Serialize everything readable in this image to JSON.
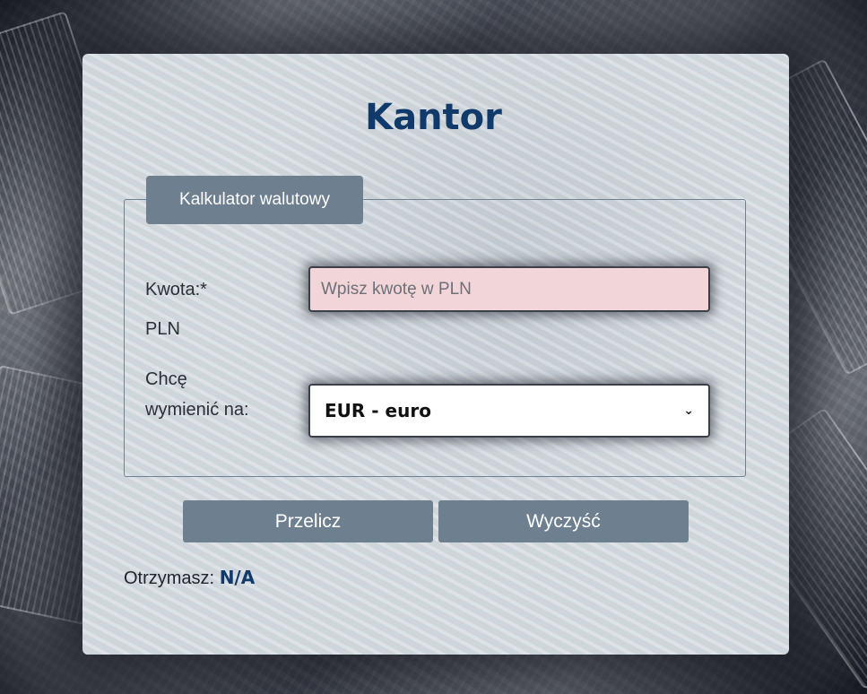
{
  "page": {
    "title": "Kantor"
  },
  "calculator": {
    "legend": "Kalkulator walutowy",
    "amount_label": "Kwota:*",
    "amount_unit": "PLN",
    "amount_value": "",
    "amount_placeholder": "Wpisz kwotę w PLN",
    "currency_label_line1": "Chcę",
    "currency_label_line2": "wymienić na:",
    "currency_selected": "EUR - euro"
  },
  "actions": {
    "convert_label": "Przelicz",
    "clear_label": "Wyczyść"
  },
  "result": {
    "label": "Otrzymasz:",
    "value": "N/A"
  },
  "colors": {
    "title": "#103a6a",
    "button_bg": "#6e8090",
    "amount_input_bg": "#f2d5d8"
  }
}
